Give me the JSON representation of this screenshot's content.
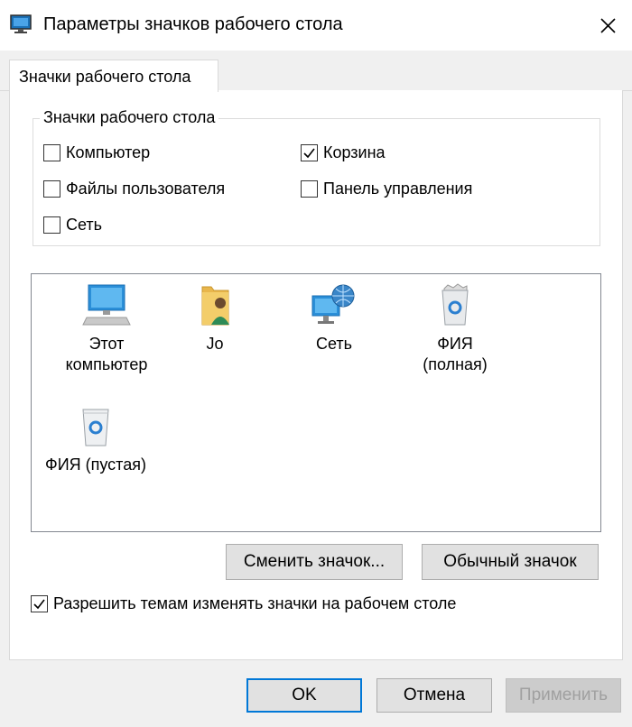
{
  "window": {
    "title": "Параметры значков рабочего стола"
  },
  "tabs": [
    {
      "label": "Значки рабочего стола"
    }
  ],
  "group": {
    "legend": "Значки рабочего стола",
    "checkboxes": [
      {
        "label": "Компьютер",
        "checked": false
      },
      {
        "label": "Корзина",
        "checked": true
      },
      {
        "label": "Файлы пользователя",
        "checked": false
      },
      {
        "label": "Панель управления",
        "checked": false
      },
      {
        "label": "Сеть",
        "checked": false
      }
    ]
  },
  "icons": [
    {
      "label": "Этот компьютер",
      "icon": "computer-icon"
    },
    {
      "label": "Jo",
      "icon": "user-folder-icon"
    },
    {
      "label": "Сеть",
      "icon": "network-icon"
    },
    {
      "label": "ФИЯ (полная)",
      "icon": "recycle-bin-full-icon"
    },
    {
      "label": "ФИЯ (пустая)",
      "icon": "recycle-bin-empty-icon"
    }
  ],
  "buttons": {
    "change_icon": "Сменить значок...",
    "default_icon": "Обычный значок",
    "ok": "OK",
    "cancel": "Отмена",
    "apply": "Применить"
  },
  "allow_themes": {
    "label": "Разрешить темам изменять значки на рабочем столе",
    "checked": true
  }
}
